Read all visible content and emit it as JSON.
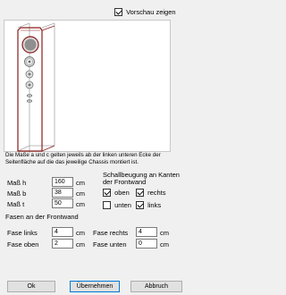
{
  "preview": {
    "checkbox_label": "Vorschau zeigen",
    "checked": true
  },
  "note": {
    "line1": "Die Maße a und c gelten jeweils ab der linken unteren Ecke der",
    "line2": "Seitenfläche auf die das jeweilige Chassis montiert ist."
  },
  "dimensions": {
    "h": {
      "label": "Maß h",
      "value": "160",
      "unit": "cm"
    },
    "b": {
      "label": "Maß b",
      "value": "38",
      "unit": "cm"
    },
    "t": {
      "label": "Maß t",
      "value": "50",
      "unit": "cm"
    }
  },
  "diffraction": {
    "title_line1": "Schallbeugung an Kanten",
    "title_line2": "der Frontwand",
    "oben": {
      "label": "oben",
      "checked": true
    },
    "rechts": {
      "label": "rechts",
      "checked": true
    },
    "unten": {
      "label": "unten",
      "checked": false
    },
    "links": {
      "label": "links",
      "checked": true
    }
  },
  "bevels": {
    "title": "Fasen an der Frontwand",
    "links": {
      "label": "Fase links",
      "value": "4",
      "unit": "cm"
    },
    "oben": {
      "label": "Fase oben",
      "value": "2",
      "unit": "cm"
    },
    "rechts": {
      "label": "Fase rechts",
      "value": "4",
      "unit": "cm"
    },
    "unten": {
      "label": "Fase unten",
      "value": "0",
      "unit": "cm"
    }
  },
  "buttons": {
    "ok": "Ok",
    "apply": "Übernehmen",
    "cancel": "Abbruch"
  }
}
